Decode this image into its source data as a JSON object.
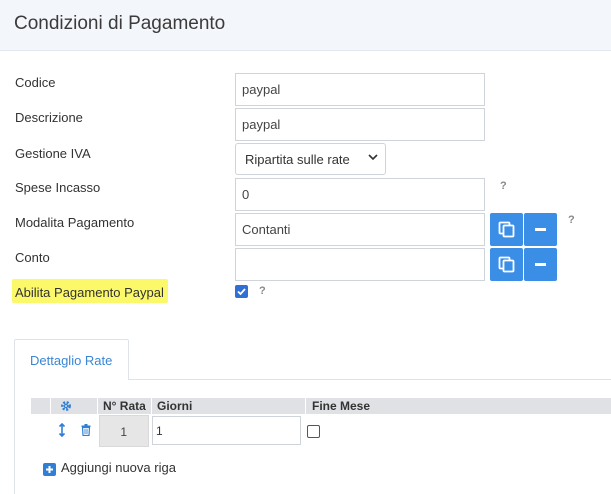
{
  "page": {
    "title": "Condizioni di Pagamento"
  },
  "form": {
    "codice": {
      "label": "Codice",
      "value": "paypal"
    },
    "descrizione": {
      "label": "Descrizione",
      "value": "paypal"
    },
    "gestione_iva": {
      "label": "Gestione IVA",
      "value": "Ripartita sulle rate"
    },
    "spese_incasso": {
      "label": "Spese Incasso",
      "value": "0"
    },
    "modalita_pagamento": {
      "label": "Modalita Pagamento",
      "value": "Contanti"
    },
    "conto": {
      "label": "Conto",
      "value": ""
    },
    "abilita_paypal": {
      "label": "Abilita Pagamento Paypal",
      "checked": true
    },
    "help_glyph": "?"
  },
  "tabs": {
    "active": "Dettaglio Rate"
  },
  "rate_grid": {
    "columns": [
      "N° Rata",
      "Giorni",
      "Fine Mese"
    ],
    "rows": [
      {
        "rata": "1",
        "giorni": "1",
        "fine_mese": false
      }
    ],
    "add_label": "Aggiungi nuova riga"
  },
  "colors": {
    "accent": "#3b8ee6",
    "highlight": "#fbf86a",
    "tab_text": "#3a86d4"
  },
  "icons": [
    "gear-icon",
    "copy-icon",
    "minus-icon",
    "help-icon",
    "move-icon",
    "trash-icon",
    "plus-icon",
    "chevron-down-icon",
    "check-icon"
  ]
}
